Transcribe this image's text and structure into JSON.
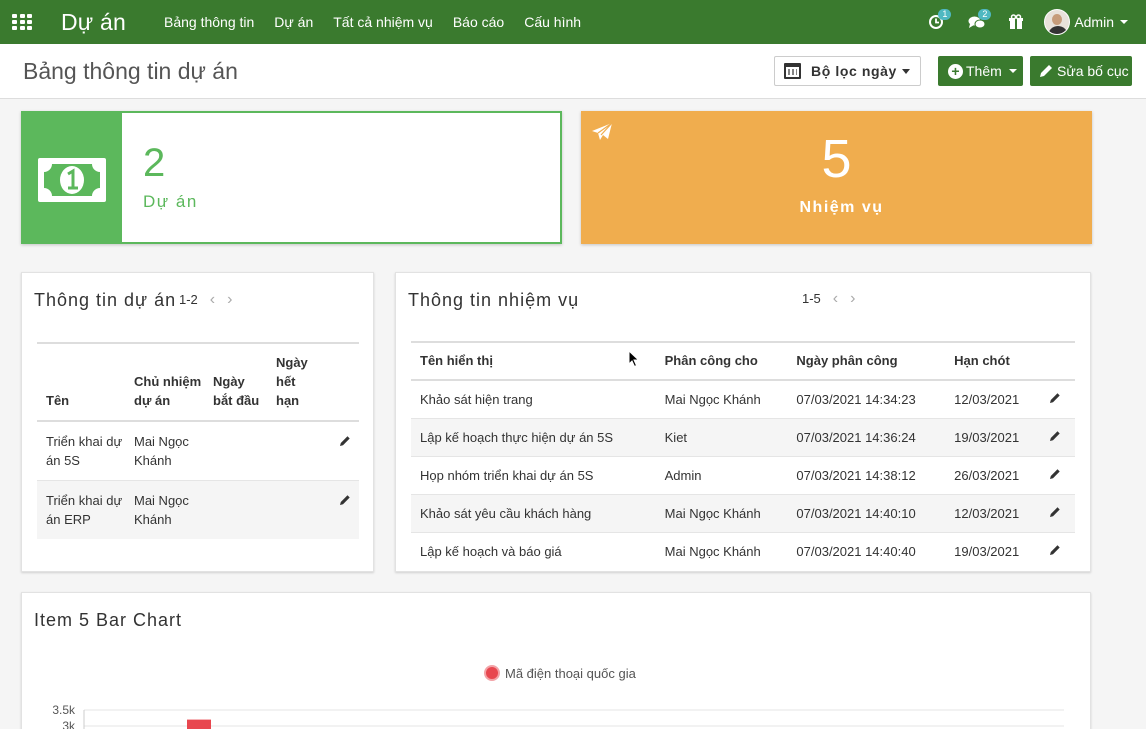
{
  "navbar": {
    "brand": "Dự án",
    "menu": [
      "Bảng thông tin",
      "Dự án",
      "Tất cả nhiệm vụ",
      "Báo cáo",
      "Cấu hình"
    ],
    "activity_count": "1",
    "message_count": "2",
    "user": "Admin"
  },
  "control": {
    "title": "Bảng thông tin dự án",
    "date_filter": "Bộ lọc ngày",
    "add_label": "Thêm",
    "edit_layout_label": "Sửa bố cục"
  },
  "kpi": {
    "projects_value": "2",
    "projects_label": "Dự án",
    "tasks_value": "5",
    "tasks_label": "Nhiệm vụ"
  },
  "projects_panel": {
    "title": "Thông tin dự án",
    "pager": "1-2",
    "columns": [
      "Tên",
      "Chủ nhiệm dự án",
      "Ngày bắt đầu",
      "Ngày hết hạn"
    ],
    "rows": [
      {
        "name": "Triển khai dự án 5S",
        "manager": "Mai Ngọc Khánh",
        "start": "",
        "end": ""
      },
      {
        "name": "Triển khai dự án ERP",
        "manager": "Mai Ngọc Khánh",
        "start": "",
        "end": ""
      }
    ]
  },
  "tasks_panel": {
    "title": "Thông tin nhiệm vụ",
    "pager": "1-5",
    "columns": [
      "Tên hiển thị",
      "Phân công cho",
      "Ngày phân công",
      "Hạn chót"
    ],
    "rows": [
      {
        "name": "Khảo sát hiện trang",
        "assignee": "Mai Ngọc Khánh",
        "assigned": "07/03/2021 14:34:23",
        "deadline": "12/03/2021"
      },
      {
        "name": "Lập kế hoạch thực hiện dự án 5S",
        "assignee": "Kiet",
        "assigned": "07/03/2021 14:36:24",
        "deadline": "19/03/2021"
      },
      {
        "name": "Họp nhóm triển khai dự án 5S",
        "assignee": "Admin",
        "assigned": "07/03/2021 14:38:12",
        "deadline": "26/03/2021"
      },
      {
        "name": "Khảo sát yêu cầu khách hàng",
        "assignee": "Mai Ngọc Khánh",
        "assigned": "07/03/2021 14:40:10",
        "deadline": "12/03/2021"
      },
      {
        "name": "Lập kế hoạch và báo giá",
        "assignee": "Mai Ngọc Khánh",
        "assigned": "07/03/2021 14:40:40",
        "deadline": "19/03/2021"
      }
    ]
  },
  "chart_panel": {
    "title": "Item 5 Bar Chart"
  },
  "chart_data": {
    "type": "bar",
    "title": "Item 5 Bar Chart",
    "legend": [
      "Mã điện thoại quốc gia"
    ],
    "legend_position": "top",
    "series": [
      {
        "name": "Mã điện thoại quốc gia",
        "color": "#e8474f",
        "values": [
          3200
        ]
      }
    ],
    "ytick_labels": [
      "3.5k",
      "3k"
    ],
    "ylim": [
      0,
      3500
    ],
    "grid": true
  },
  "colors": {
    "navbar": "#3a7a2e",
    "projects_card": "#5cb85c",
    "tasks_card": "#f0ad4e",
    "bar": "#e8474f"
  }
}
